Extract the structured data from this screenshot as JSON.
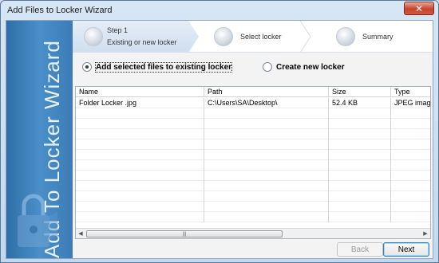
{
  "window": {
    "title": "Add Files to Locker Wizard",
    "close_symbol": "✕"
  },
  "side_panel": {
    "title": "Add To Locker Wizard",
    "icon": "lock-icon"
  },
  "steps": [
    {
      "step_label": "Step 1",
      "name": "Existing or new locker",
      "active": true
    },
    {
      "name": "Select locker",
      "active": false
    },
    {
      "name": "Summary",
      "active": false
    }
  ],
  "options": {
    "existing_label": "Add selected files to existing locker",
    "existing_checked": true,
    "new_label": "Create new locker",
    "new_checked": false
  },
  "table": {
    "columns": [
      "Name",
      "Path",
      "Size",
      "Type"
    ],
    "rows": [
      [
        "Folder Locker .jpg",
        "C:\\Users\\SA\\Desktop\\",
        "52.4 KB",
        "JPEG image"
      ]
    ]
  },
  "scrollbar": {
    "left_arrow": "◀",
    "right_arrow": "▶",
    "grip": "|||"
  },
  "buttons": {
    "back": "Back",
    "next": "Next"
  },
  "colors": {
    "side_panel": "#3c7cb6",
    "accent": "#3c7fb1"
  }
}
